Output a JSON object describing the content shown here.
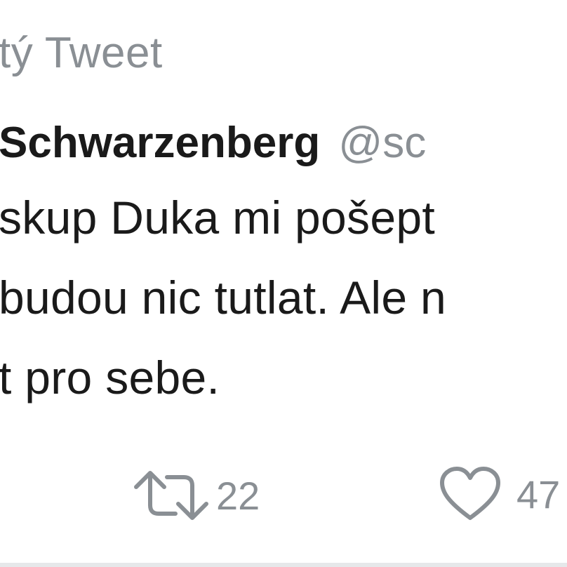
{
  "header": {
    "label": "tý Tweet"
  },
  "author": {
    "name": "Schwarzenberg",
    "handle": "@sc"
  },
  "tweet": {
    "lines": [
      "skup Duka mi pošept",
      "budou nic tutlat. Ale n",
      "t pro sebe."
    ]
  },
  "actions": {
    "retweet": {
      "icon": "retweet-icon",
      "count": "22"
    },
    "like": {
      "icon": "heart-icon",
      "count": "47"
    }
  },
  "colors": {
    "text": "#1a1a1a",
    "muted": "#8a8f94",
    "background": "#ffffff",
    "divider": "#e6e8ea"
  }
}
